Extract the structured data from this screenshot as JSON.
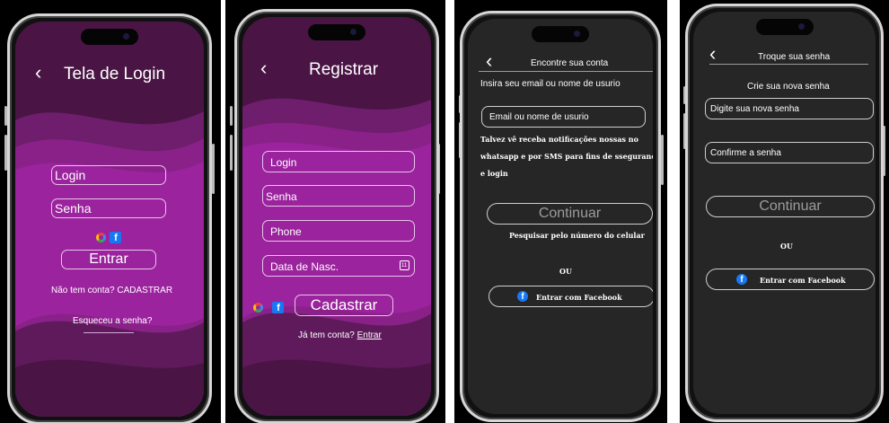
{
  "screens": {
    "login": {
      "back": "‹",
      "title": "Tela de Login",
      "login_placeholder": "Login",
      "senha_placeholder": "Senha",
      "enter_button": "Entrar",
      "no_account": "Não tem conta? CADASTRAR",
      "forgot": "Esqueceu a senha?",
      "social_icons": [
        "google-icon",
        "facebook-icon"
      ]
    },
    "register": {
      "back": "‹",
      "title": "Registrar",
      "login_placeholder": "Login",
      "senha_placeholder": "Senha",
      "phone_placeholder": "Phone",
      "birth_placeholder": "Data de Nasc.",
      "register_button": "Cadastrar",
      "has_account": "Já tem conta?",
      "enter_link": "Entrar",
      "social_icons": [
        "google-icon",
        "facebook-icon"
      ],
      "calendar_icon": "calendar-icon"
    },
    "find_account": {
      "back": "‹",
      "title": "Encontre sua conta",
      "instruction": "Insira seu email ou nome de usurio",
      "email_placeholder": "Email ou nome de usurio",
      "notice_line1": "Talvez vê receba notificações nossas no",
      "notice_line2": "whatsapp e por SMS para fins de ssegurança",
      "notice_line3": "e login",
      "continue_button": "Continuar",
      "search_phone": "Pesquisar pelo número do celular",
      "or": "OU",
      "facebook_button": "Entrar com Facebook"
    },
    "change_password": {
      "back": "‹",
      "title": "Troque sua senha",
      "subtitle": "Crie sua nova senha",
      "new_password_placeholder": "Digite sua nova senha",
      "confirm_placeholder": "Confirme a senha",
      "continue_button": "Continuar",
      "or": "OU",
      "facebook_button": "Entrar com Facebook"
    }
  },
  "colors": {
    "purple_dark": "#4a1545",
    "purple_mid": "#6e1e6c",
    "purple_bright": "#9b239d",
    "dark_screen": "#262626",
    "facebook_blue": "#1877f2"
  }
}
